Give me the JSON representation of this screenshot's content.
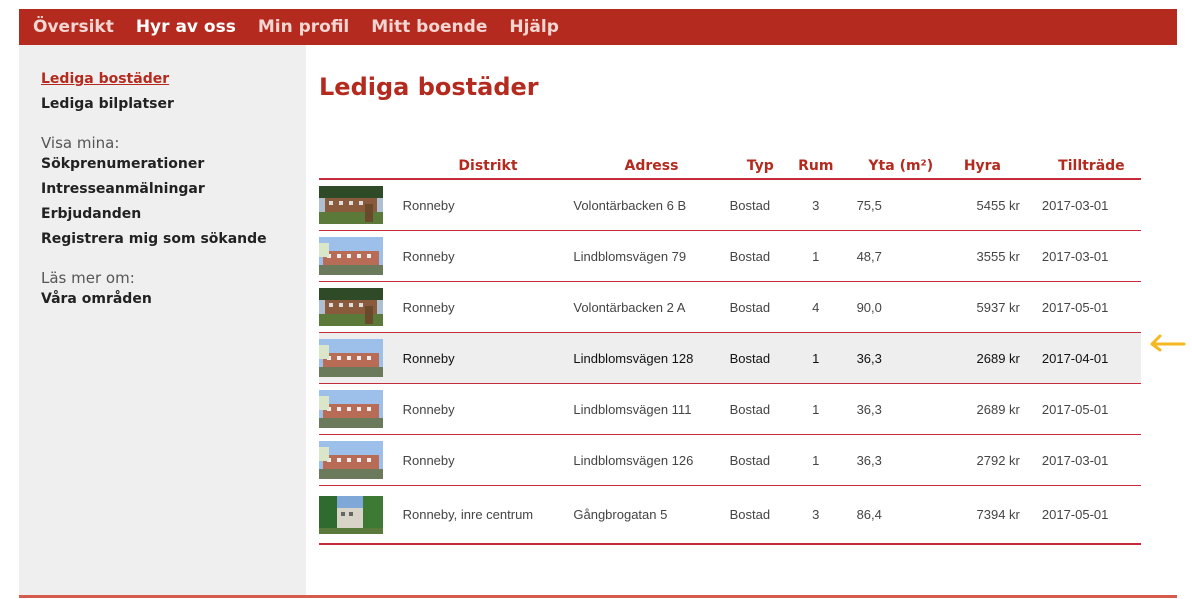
{
  "nav": {
    "items": [
      "Översikt",
      "Hyr av oss",
      "Min profil",
      "Mitt boende",
      "Hjälp"
    ],
    "active_index": 1
  },
  "sidebar": {
    "links_top": [
      "Lediga bostäder",
      "Lediga bilplatser"
    ],
    "visa_heading": "Visa mina:",
    "links_visa": [
      "Sökprenumerationer",
      "Intresseanmälningar",
      "Erbjudanden",
      "Registrera mig som sökande"
    ],
    "las_heading": "Läs mer om:",
    "links_las": [
      "Våra områden"
    ]
  },
  "main": {
    "title": "Lediga bostäder",
    "columns": [
      "Distrikt",
      "Adress",
      "Typ",
      "Rum",
      "Yta (m²)",
      "Hyra",
      "Tillträde"
    ],
    "rows": [
      {
        "distrikt": "Ronneby",
        "adress": "Volontärbacken 6 B",
        "typ": "Bostad",
        "rum": "3",
        "yta": "75,5",
        "hyra": "5455 kr",
        "tilltrade": "2017-03-01",
        "photo": "building-photo-brick"
      },
      {
        "distrikt": "Ronneby",
        "adress": "Lindblomsvägen 79",
        "typ": "Bostad",
        "rum": "1",
        "yta": "48,7",
        "hyra": "3555 kr",
        "tilltrade": "2017-03-01",
        "photo": "building-photo-sky"
      },
      {
        "distrikt": "Ronneby",
        "adress": "Volontärbacken 2 A",
        "typ": "Bostad",
        "rum": "4",
        "yta": "90,0",
        "hyra": "5937 kr",
        "tilltrade": "2017-05-01",
        "photo": "building-photo-brick"
      },
      {
        "distrikt": "Ronneby",
        "adress": "Lindblomsvägen 128",
        "typ": "Bostad",
        "rum": "1",
        "yta": "36,3",
        "hyra": "2689 kr",
        "tilltrade": "2017-04-01",
        "photo": "building-photo-sky"
      },
      {
        "distrikt": "Ronneby",
        "adress": "Lindblomsvägen 111",
        "typ": "Bostad",
        "rum": "1",
        "yta": "36,3",
        "hyra": "2689 kr",
        "tilltrade": "2017-05-01",
        "photo": "building-photo-sky"
      },
      {
        "distrikt": "Ronneby",
        "adress": "Lindblomsvägen 126",
        "typ": "Bostad",
        "rum": "1",
        "yta": "36,3",
        "hyra": "2792 kr",
        "tilltrade": "2017-03-01",
        "photo": "building-photo-sky"
      },
      {
        "distrikt": "Ronneby, inre centrum",
        "adress": "Gångbrogatan 5",
        "typ": "Bostad",
        "rum": "3",
        "yta": "86,4",
        "hyra": "7394 kr",
        "tilltrade": "2017-05-01",
        "photo": "building-photo-trees"
      }
    ],
    "highlighted_row_index": 3
  },
  "colors": {
    "brand": "#b52a1e",
    "row_divider": "#c62b3b",
    "sidebar_bg": "#efefef",
    "highlight_bg": "#eeeeee",
    "arrow": "#f5b820"
  }
}
